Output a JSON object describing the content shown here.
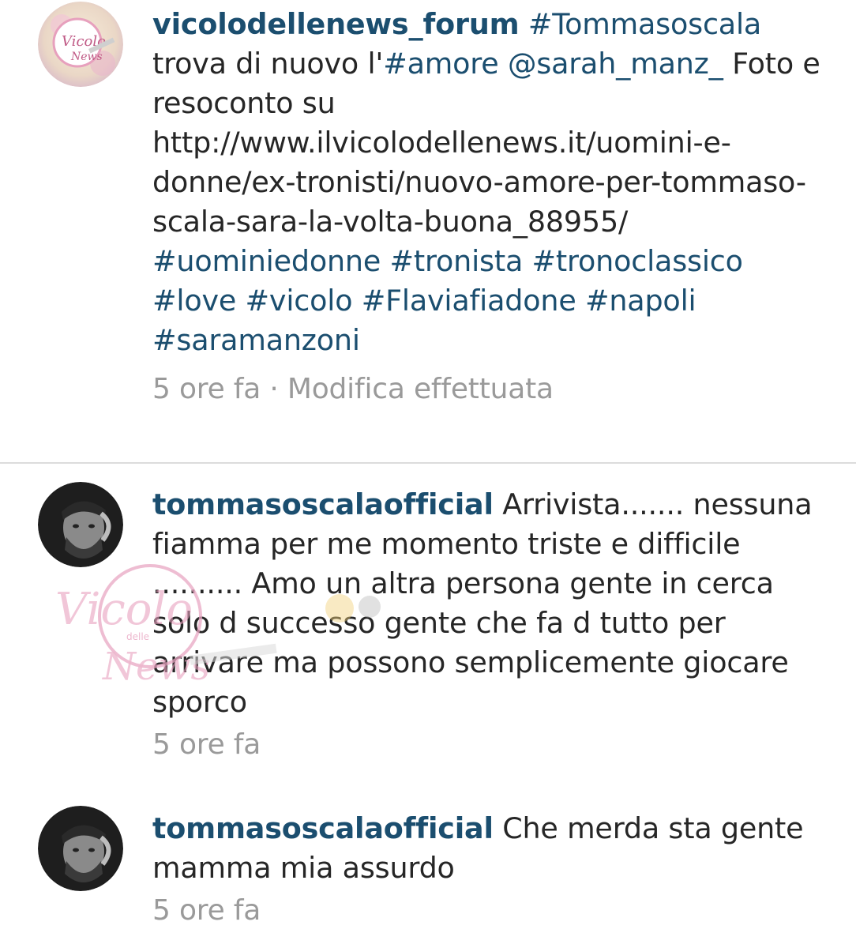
{
  "comments": [
    {
      "username": "vicolodellenews_forum",
      "segments": [
        {
          "t": " "
        },
        {
          "t": "#Tommasoscala",
          "tag": true
        },
        {
          "t": " trova di nuovo l'"
        },
        {
          "t": "#amore",
          "tag": true
        },
        {
          "t": " "
        },
        {
          "t": "@sarah_manz_",
          "tag": true
        },
        {
          "t": " Foto e resoconto su http://www.ilvicolodellenews.it/uomini-e-donne/ex-tronisti/nuovo-amore-per-tommaso-scala-sara-la-volta-buona_88955/"
        }
      ],
      "hashtags": [
        "#uominiedonne",
        "#tronista",
        "#tronoclassico",
        "#love",
        "#vicolo",
        "#Flaviafiadone",
        "#napoli",
        "#saramanzoni"
      ],
      "time": "5 ore fa",
      "edited": " · Modifica effettuata",
      "avatar_icon": "vicolo-logo-avatar-icon"
    },
    {
      "username": "tommasoscalaofficial",
      "segments": [
        {
          "t": " Arrivista....... nessuna fiamma per me momento triste e difficile .......... Amo un altra persona gente in cerca solo d successo gente che fa d tutto per arrivare ma possono semplicemente giocare sporco"
        }
      ],
      "time": "5 ore fa",
      "avatar_icon": "profile-photo-avatar-icon"
    },
    {
      "username": "tommasoscalaofficial",
      "segments": [
        {
          "t": " Che merda sta gente mamma mia assurdo"
        }
      ],
      "time": "5 ore fa",
      "avatar_icon": "profile-photo-avatar-icon"
    }
  ],
  "watermark": {
    "line1": "Vicolo",
    "line2": "delle",
    "line3": "News"
  }
}
